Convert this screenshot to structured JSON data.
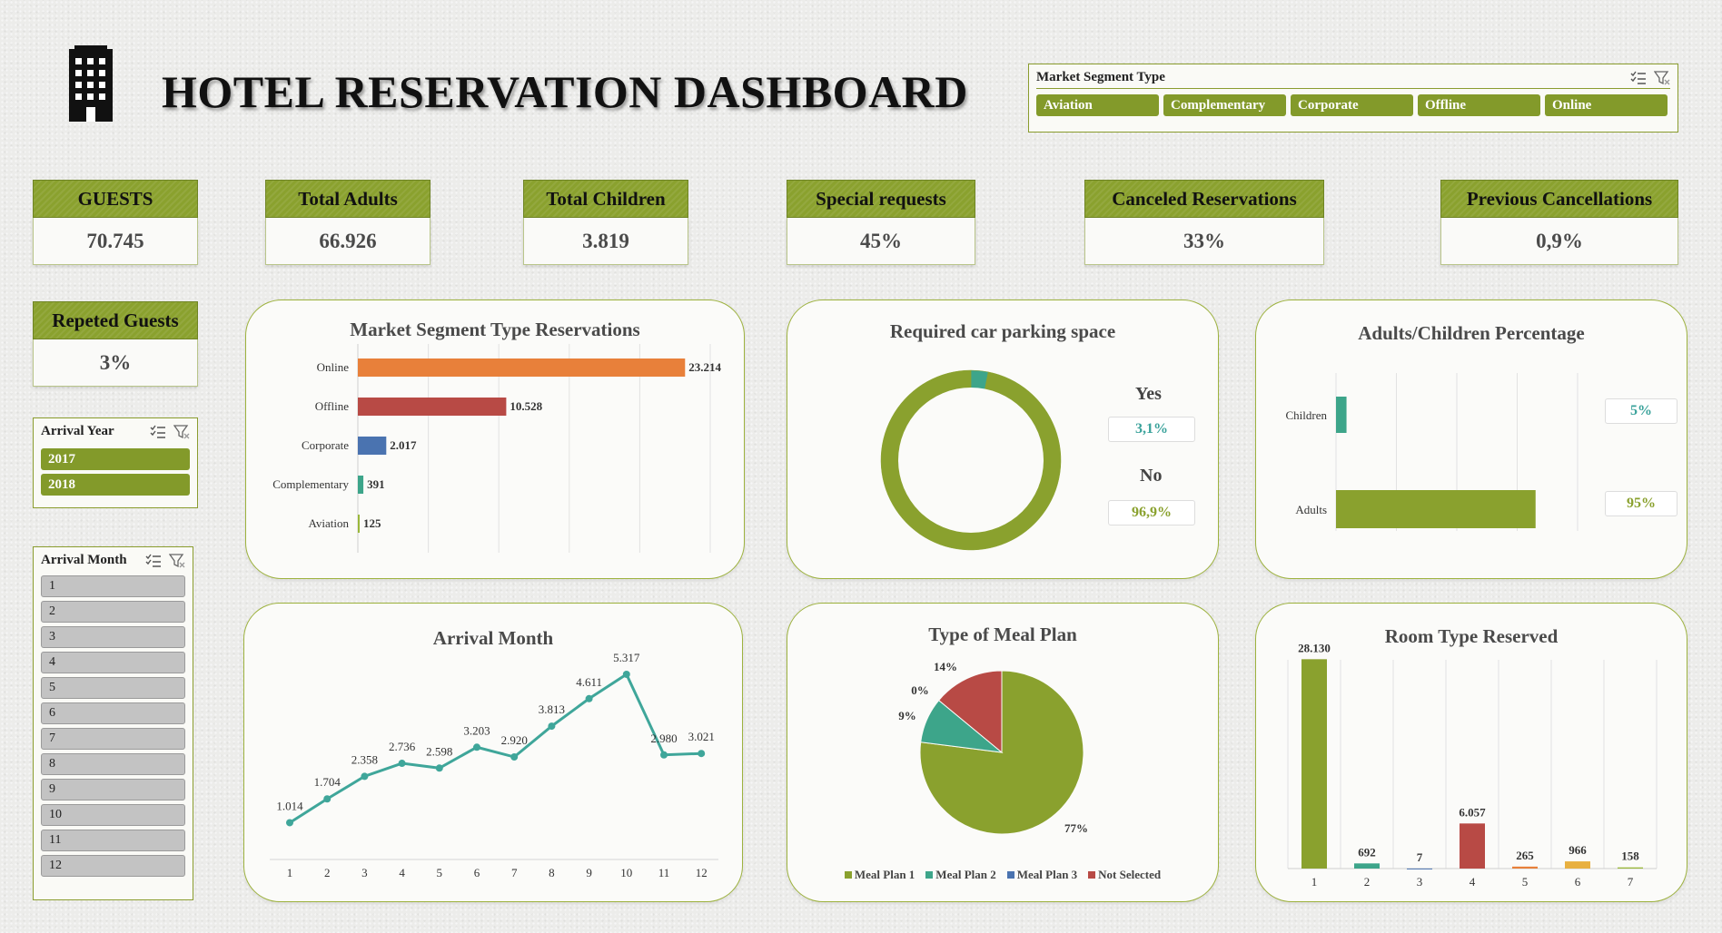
{
  "header": {
    "title": "HOTEL RESERVATION DASHBOARD"
  },
  "icons": {
    "building": "building-icon",
    "multiselect": "multiselect-icon",
    "clear_filter": "clear-filter-icon"
  },
  "colors": {
    "accent_green": "#839a2a",
    "orange": "#e8803a",
    "red": "#b84a45",
    "blue": "#4a73b0",
    "teal": "#3da58a",
    "yellow": "#e8b040"
  },
  "slicers": {
    "market_segment": {
      "title": "Market Segment Type",
      "items": [
        "Aviation",
        "Complementary",
        "Corporate",
        "Offline",
        "Online"
      ]
    },
    "arrival_year": {
      "title": "Arrival Year",
      "items": [
        "2017",
        "2018"
      ]
    },
    "arrival_month": {
      "title": "Arrival Month",
      "items": [
        "1",
        "2",
        "3",
        "4",
        "5",
        "6",
        "7",
        "8",
        "9",
        "10",
        "11",
        "12"
      ]
    }
  },
  "kpis": {
    "guests": {
      "label": "GUESTS",
      "value": "70.745"
    },
    "adults": {
      "label": "Total Adults",
      "value": "66.926"
    },
    "children": {
      "label": "Total Children",
      "value": "3.819"
    },
    "special": {
      "label": "Special requests",
      "value": "45%"
    },
    "canceled": {
      "label": "Canceled Reservations",
      "value": "33%"
    },
    "previous": {
      "label": "Previous Cancellations",
      "value": "0,9%"
    },
    "repeated": {
      "label": "Repeted Guests",
      "value": "3%"
    }
  },
  "chart_data": [
    {
      "id": "market_segment",
      "type": "bar",
      "orientation": "horizontal",
      "title": "Market Segment Type Reservations",
      "categories": [
        "Online",
        "Offline",
        "Corporate",
        "Complementary",
        "Aviation"
      ],
      "values": [
        23214,
        10528,
        2017,
        391,
        125
      ],
      "labels": [
        "23.214",
        "10.528",
        "2.017",
        "391",
        "125"
      ],
      "colors": [
        "#e8803a",
        "#b84a45",
        "#4a73b0",
        "#3da58a",
        "#9ab83a"
      ],
      "xlim": [
        0,
        25000
      ],
      "grid": true
    },
    {
      "id": "parking",
      "type": "pie",
      "donut": true,
      "title": "Required car parking space",
      "categories": [
        "Yes",
        "No"
      ],
      "values": [
        3.1,
        96.9
      ],
      "labels": [
        "3,1%",
        "96,9%"
      ],
      "colors": [
        "#3da58a",
        "#8aa12e"
      ]
    },
    {
      "id": "adults_children",
      "type": "bar",
      "orientation": "horizontal",
      "title": "Adults/Children Percentage",
      "categories": [
        "Children",
        "Adults"
      ],
      "values": [
        5,
        95
      ],
      "labels": [
        "5%",
        "95%"
      ],
      "colors": [
        "#3da58a",
        "#8aa12e"
      ],
      "xlim": [
        0,
        115
      ],
      "grid": true
    },
    {
      "id": "arrival_month",
      "type": "line",
      "title": "Arrival Month",
      "x": [
        1,
        2,
        3,
        4,
        5,
        6,
        7,
        8,
        9,
        10,
        11,
        12
      ],
      "values": [
        1014,
        1704,
        2358,
        2736,
        2598,
        3203,
        2920,
        3813,
        4611,
        5317,
        2980,
        3021
      ],
      "labels": [
        "1.014",
        "1.704",
        "2.358",
        "2.736",
        "2.598",
        "3.203",
        "2.920",
        "3.813",
        "4.611",
        "5.317",
        "2.980",
        "3.021"
      ],
      "color": "#3fa69a",
      "ylim": [
        0,
        6000
      ]
    },
    {
      "id": "meal_plan",
      "type": "pie",
      "title": "Type of Meal Plan",
      "categories": [
        "Meal Plan 1",
        "Meal Plan 2",
        "Meal Plan 3",
        "Not Selected"
      ],
      "values": [
        77,
        9,
        0,
        14
      ],
      "labels": [
        "77%",
        "9%",
        "0%",
        "14%"
      ],
      "colors": [
        "#8aa12e",
        "#3da58a",
        "#4a73b0",
        "#b84a45"
      ],
      "legend": "bottom"
    },
    {
      "id": "room_type",
      "type": "bar",
      "title": "Room Type Reserved",
      "categories": [
        "1",
        "2",
        "3",
        "4",
        "5",
        "6",
        "7"
      ],
      "values": [
        28130,
        692,
        7,
        6057,
        265,
        966,
        158
      ],
      "labels": [
        "28.130",
        "692",
        "7",
        "6.057",
        "265",
        "966",
        "158"
      ],
      "colors": [
        "#8aa12e",
        "#3da58a",
        "#4a73b0",
        "#b84a45",
        "#e8803a",
        "#e8b040",
        "#9ab83a"
      ],
      "ylim": [
        0,
        30000
      ],
      "grid": true
    }
  ]
}
